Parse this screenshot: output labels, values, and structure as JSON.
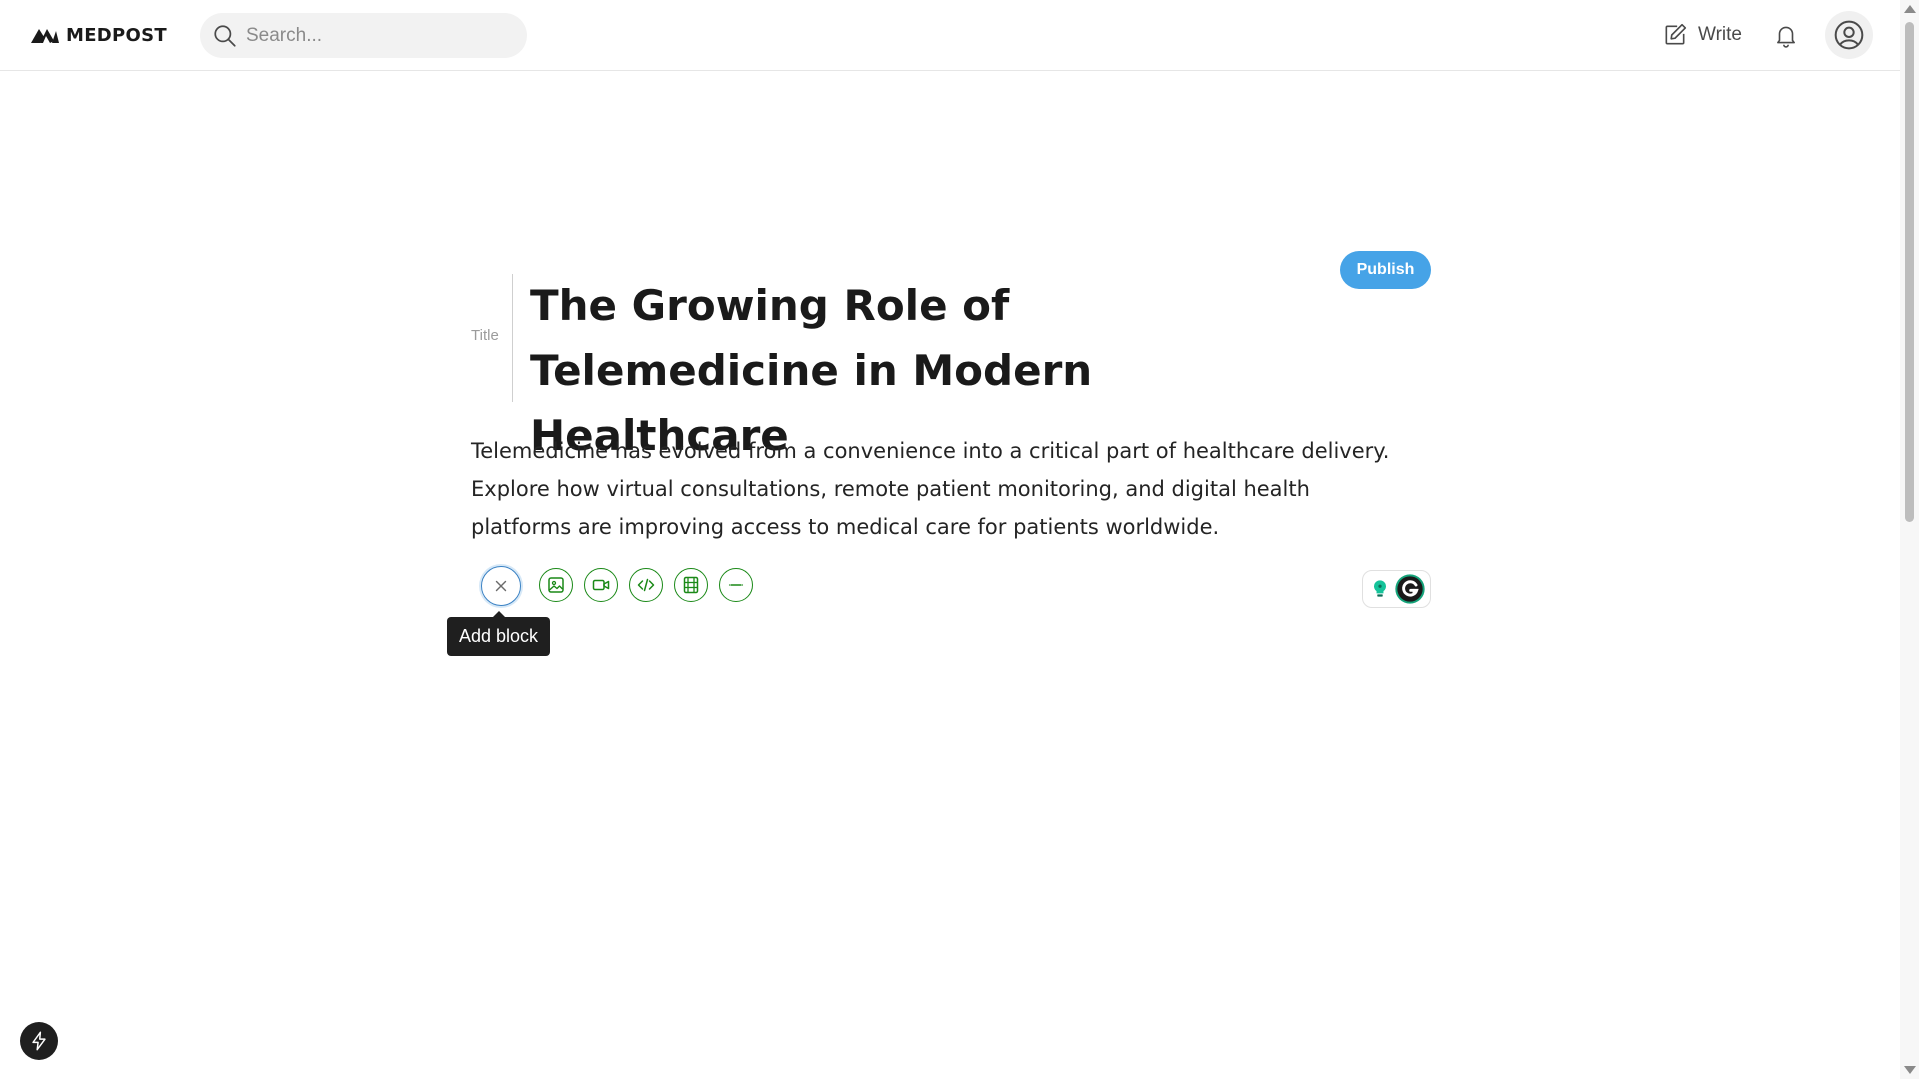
{
  "app": {
    "brand": "MEDPOST"
  },
  "header": {
    "search_placeholder": "Search...",
    "write_label": "Write"
  },
  "editor": {
    "publish_label": "Publish",
    "title_label": "Title",
    "title": "The Growing Role of Telemedicine in Modern Healthcare",
    "body": "Telemedicine has evolved from a convenience into a critical part of healthcare delivery. Explore how virtual consultations, remote patient monitoring, and digital health platforms are improving access to medical care for patients worldwide."
  },
  "block_toolbar": {
    "tooltip": "Add block",
    "buttons": [
      {
        "icon": "close-icon"
      },
      {
        "icon": "image-icon"
      },
      {
        "icon": "video-icon"
      },
      {
        "icon": "code-icon"
      },
      {
        "icon": "film-embed-icon"
      },
      {
        "icon": "separator-icon"
      }
    ]
  },
  "colors": {
    "accent_green": "#1a8917",
    "publish_blue": "#46a3e7",
    "tooltip_bg": "#1f1f1f"
  }
}
